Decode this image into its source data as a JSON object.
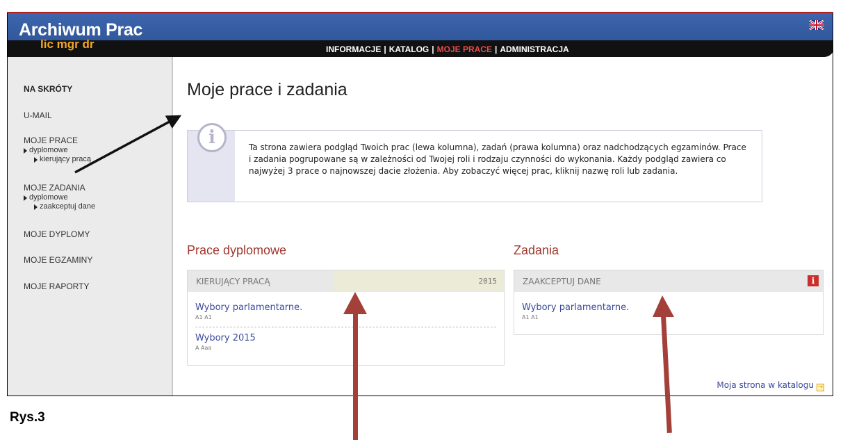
{
  "header": {
    "app_title": "Archiwum Prac",
    "subtitle": "lic mgr dr",
    "language_flag": "uk-flag-icon",
    "nav": [
      {
        "label": "INFORMACJE",
        "active": false
      },
      {
        "label": "KATALOG",
        "active": false
      },
      {
        "label": "MOJE PRACE",
        "active": true
      },
      {
        "label": "ADMINISTRACJA",
        "active": false
      }
    ],
    "nav_separator": "|"
  },
  "sidebar": {
    "heading": "NA SKRÓTY",
    "umail": "U-MAIL",
    "moje_prace": "MOJE PRACE",
    "moje_prace_sub1": "dyplomowe",
    "moje_prace_sub2": "kierujący pracą",
    "moje_zadania": "MOJE ZADANIA",
    "moje_zadania_sub1": "dyplomowe",
    "moje_zadania_sub2": "zaakceptuj dane",
    "moje_dyplomy": "MOJE DYPLOMY",
    "moje_egzaminy": "MOJE EGZAMINY",
    "moje_raporty": "MOJE RAPORTY"
  },
  "main": {
    "title": "Moje prace i zadania",
    "info_icon": "i",
    "info_text": "Ta strona zawiera podgląd Twoich prac (lewa kolumna), zadań (prawa kolumna) oraz nadchodzących egzaminów. Prace i zadania pogrupowane są w zależności od Twojej roli i rodzaju czynności do wykonania. Każdy podgląd zawiera co najwyżej 3 prace o najnowszej dacie złożenia. Aby zobaczyć więcej prac, kliknij nazwę roli lub zadania.",
    "prace": {
      "title": "Prace dyplomowe",
      "panel_label": "KIERUJĄCY PRACĄ",
      "panel_year": "2015",
      "entry1_title": "Wybory parlamentarne.",
      "entry1_author": "A1 A1",
      "entry2_title": "Wybory 2015",
      "entry2_author": "A Aaa"
    },
    "zadania": {
      "title": "Zadania",
      "panel_label": "ZAAKCEPTUJ DANE",
      "badge": "i",
      "entry1_title": "Wybory parlamentarne.",
      "entry1_author": "A1 A1"
    },
    "catalog_link": "Moja strona w katalogu",
    "catalog_icon": "→"
  },
  "caption": "Rys.3",
  "colors": {
    "header_blue": "#3d66ad",
    "nav_active": "#e94c4c",
    "section_title": "#a0392f",
    "link": "#3b4a9c",
    "annotation_arrow": "#a3403a"
  }
}
